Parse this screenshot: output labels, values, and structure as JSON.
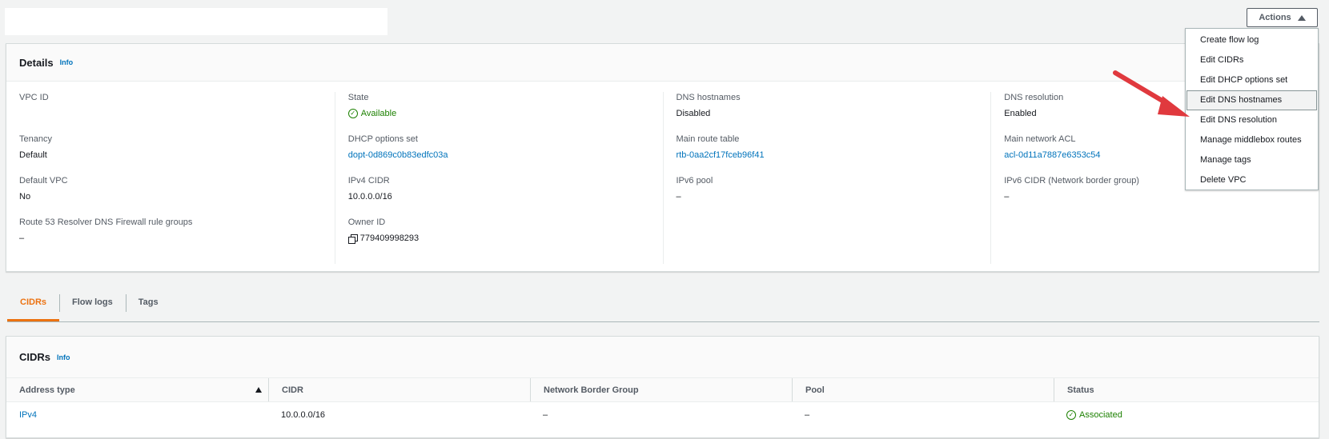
{
  "header": {
    "actions_label": "Actions"
  },
  "actions_menu": {
    "items": [
      {
        "label": "Create flow log"
      },
      {
        "label": "Edit CIDRs"
      },
      {
        "label": "Edit DHCP options set"
      },
      {
        "label": "Edit DNS hostnames"
      },
      {
        "label": "Edit DNS resolution"
      },
      {
        "label": "Manage middlebox routes"
      },
      {
        "label": "Manage tags"
      },
      {
        "label": "Delete VPC"
      }
    ]
  },
  "details": {
    "title": "Details",
    "info": "Info",
    "vpc_id": {
      "label": "VPC ID",
      "value": ""
    },
    "tenancy": {
      "label": "Tenancy",
      "value": "Default"
    },
    "default_vpc": {
      "label": "Default VPC",
      "value": "No"
    },
    "route53": {
      "label": "Route 53 Resolver DNS Firewall rule groups",
      "value": "–"
    },
    "state": {
      "label": "State",
      "value": "Available"
    },
    "dhcp": {
      "label": "DHCP options set",
      "value": "dopt-0d869c0b83edfc03a"
    },
    "ipv4_cidr": {
      "label": "IPv4 CIDR",
      "value": "10.0.0.0/16"
    },
    "owner_id": {
      "label": "Owner ID",
      "value": "779409998293"
    },
    "dns_hostnames": {
      "label": "DNS hostnames",
      "value": "Disabled"
    },
    "main_route_table": {
      "label": "Main route table",
      "value": "rtb-0aa2cf17fceb96f41"
    },
    "ipv6_pool": {
      "label": "IPv6 pool",
      "value": "–"
    },
    "dns_resolution": {
      "label": "DNS resolution",
      "value": "Enabled"
    },
    "main_acl": {
      "label": "Main network ACL",
      "value": "acl-0d11a7887e6353c54"
    },
    "ipv6_cidr": {
      "label": "IPv6 CIDR (Network border group)",
      "value": "–"
    }
  },
  "tabs": [
    {
      "label": "CIDRs"
    },
    {
      "label": "Flow logs"
    },
    {
      "label": "Tags"
    }
  ],
  "cidrs": {
    "title": "CIDRs",
    "info": "Info",
    "columns": [
      "Address type",
      "CIDR",
      "Network Border Group",
      "Pool",
      "Status"
    ],
    "rows": [
      {
        "address_type": "IPv4",
        "cidr": "10.0.0.0/16",
        "nbg": "–",
        "pool": "–",
        "status": "Associated"
      }
    ]
  },
  "colors": {
    "accent": "#ec7211",
    "link": "#0073bb",
    "success": "#1d8102",
    "arrow": "#e0393e"
  }
}
